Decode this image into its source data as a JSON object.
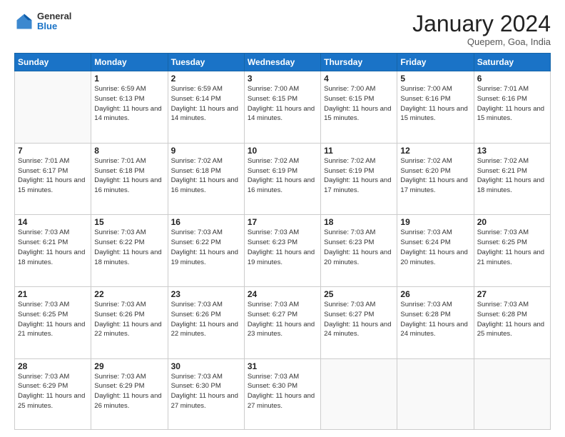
{
  "header": {
    "logo": {
      "general": "General",
      "blue": "Blue"
    },
    "title": "January 2024",
    "subtitle": "Quepem, Goa, India"
  },
  "weekdays": [
    "Sunday",
    "Monday",
    "Tuesday",
    "Wednesday",
    "Thursday",
    "Friday",
    "Saturday"
  ],
  "weeks": [
    [
      {
        "day": "",
        "sunrise": "",
        "sunset": "",
        "daylight": ""
      },
      {
        "day": "1",
        "sunrise": "Sunrise: 6:59 AM",
        "sunset": "Sunset: 6:13 PM",
        "daylight": "Daylight: 11 hours and 14 minutes."
      },
      {
        "day": "2",
        "sunrise": "Sunrise: 6:59 AM",
        "sunset": "Sunset: 6:14 PM",
        "daylight": "Daylight: 11 hours and 14 minutes."
      },
      {
        "day": "3",
        "sunrise": "Sunrise: 7:00 AM",
        "sunset": "Sunset: 6:15 PM",
        "daylight": "Daylight: 11 hours and 14 minutes."
      },
      {
        "day": "4",
        "sunrise": "Sunrise: 7:00 AM",
        "sunset": "Sunset: 6:15 PM",
        "daylight": "Daylight: 11 hours and 15 minutes."
      },
      {
        "day": "5",
        "sunrise": "Sunrise: 7:00 AM",
        "sunset": "Sunset: 6:16 PM",
        "daylight": "Daylight: 11 hours and 15 minutes."
      },
      {
        "day": "6",
        "sunrise": "Sunrise: 7:01 AM",
        "sunset": "Sunset: 6:16 PM",
        "daylight": "Daylight: 11 hours and 15 minutes."
      }
    ],
    [
      {
        "day": "7",
        "sunrise": "Sunrise: 7:01 AM",
        "sunset": "Sunset: 6:17 PM",
        "daylight": "Daylight: 11 hours and 15 minutes."
      },
      {
        "day": "8",
        "sunrise": "Sunrise: 7:01 AM",
        "sunset": "Sunset: 6:18 PM",
        "daylight": "Daylight: 11 hours and 16 minutes."
      },
      {
        "day": "9",
        "sunrise": "Sunrise: 7:02 AM",
        "sunset": "Sunset: 6:18 PM",
        "daylight": "Daylight: 11 hours and 16 minutes."
      },
      {
        "day": "10",
        "sunrise": "Sunrise: 7:02 AM",
        "sunset": "Sunset: 6:19 PM",
        "daylight": "Daylight: 11 hours and 16 minutes."
      },
      {
        "day": "11",
        "sunrise": "Sunrise: 7:02 AM",
        "sunset": "Sunset: 6:19 PM",
        "daylight": "Daylight: 11 hours and 17 minutes."
      },
      {
        "day": "12",
        "sunrise": "Sunrise: 7:02 AM",
        "sunset": "Sunset: 6:20 PM",
        "daylight": "Daylight: 11 hours and 17 minutes."
      },
      {
        "day": "13",
        "sunrise": "Sunrise: 7:02 AM",
        "sunset": "Sunset: 6:21 PM",
        "daylight": "Daylight: 11 hours and 18 minutes."
      }
    ],
    [
      {
        "day": "14",
        "sunrise": "Sunrise: 7:03 AM",
        "sunset": "Sunset: 6:21 PM",
        "daylight": "Daylight: 11 hours and 18 minutes."
      },
      {
        "day": "15",
        "sunrise": "Sunrise: 7:03 AM",
        "sunset": "Sunset: 6:22 PM",
        "daylight": "Daylight: 11 hours and 18 minutes."
      },
      {
        "day": "16",
        "sunrise": "Sunrise: 7:03 AM",
        "sunset": "Sunset: 6:22 PM",
        "daylight": "Daylight: 11 hours and 19 minutes."
      },
      {
        "day": "17",
        "sunrise": "Sunrise: 7:03 AM",
        "sunset": "Sunset: 6:23 PM",
        "daylight": "Daylight: 11 hours and 19 minutes."
      },
      {
        "day": "18",
        "sunrise": "Sunrise: 7:03 AM",
        "sunset": "Sunset: 6:23 PM",
        "daylight": "Daylight: 11 hours and 20 minutes."
      },
      {
        "day": "19",
        "sunrise": "Sunrise: 7:03 AM",
        "sunset": "Sunset: 6:24 PM",
        "daylight": "Daylight: 11 hours and 20 minutes."
      },
      {
        "day": "20",
        "sunrise": "Sunrise: 7:03 AM",
        "sunset": "Sunset: 6:25 PM",
        "daylight": "Daylight: 11 hours and 21 minutes."
      }
    ],
    [
      {
        "day": "21",
        "sunrise": "Sunrise: 7:03 AM",
        "sunset": "Sunset: 6:25 PM",
        "daylight": "Daylight: 11 hours and 21 minutes."
      },
      {
        "day": "22",
        "sunrise": "Sunrise: 7:03 AM",
        "sunset": "Sunset: 6:26 PM",
        "daylight": "Daylight: 11 hours and 22 minutes."
      },
      {
        "day": "23",
        "sunrise": "Sunrise: 7:03 AM",
        "sunset": "Sunset: 6:26 PM",
        "daylight": "Daylight: 11 hours and 22 minutes."
      },
      {
        "day": "24",
        "sunrise": "Sunrise: 7:03 AM",
        "sunset": "Sunset: 6:27 PM",
        "daylight": "Daylight: 11 hours and 23 minutes."
      },
      {
        "day": "25",
        "sunrise": "Sunrise: 7:03 AM",
        "sunset": "Sunset: 6:27 PM",
        "daylight": "Daylight: 11 hours and 24 minutes."
      },
      {
        "day": "26",
        "sunrise": "Sunrise: 7:03 AM",
        "sunset": "Sunset: 6:28 PM",
        "daylight": "Daylight: 11 hours and 24 minutes."
      },
      {
        "day": "27",
        "sunrise": "Sunrise: 7:03 AM",
        "sunset": "Sunset: 6:28 PM",
        "daylight": "Daylight: 11 hours and 25 minutes."
      }
    ],
    [
      {
        "day": "28",
        "sunrise": "Sunrise: 7:03 AM",
        "sunset": "Sunset: 6:29 PM",
        "daylight": "Daylight: 11 hours and 25 minutes."
      },
      {
        "day": "29",
        "sunrise": "Sunrise: 7:03 AM",
        "sunset": "Sunset: 6:29 PM",
        "daylight": "Daylight: 11 hours and 26 minutes."
      },
      {
        "day": "30",
        "sunrise": "Sunrise: 7:03 AM",
        "sunset": "Sunset: 6:30 PM",
        "daylight": "Daylight: 11 hours and 27 minutes."
      },
      {
        "day": "31",
        "sunrise": "Sunrise: 7:03 AM",
        "sunset": "Sunset: 6:30 PM",
        "daylight": "Daylight: 11 hours and 27 minutes."
      },
      {
        "day": "",
        "sunrise": "",
        "sunset": "",
        "daylight": ""
      },
      {
        "day": "",
        "sunrise": "",
        "sunset": "",
        "daylight": ""
      },
      {
        "day": "",
        "sunrise": "",
        "sunset": "",
        "daylight": ""
      }
    ]
  ]
}
